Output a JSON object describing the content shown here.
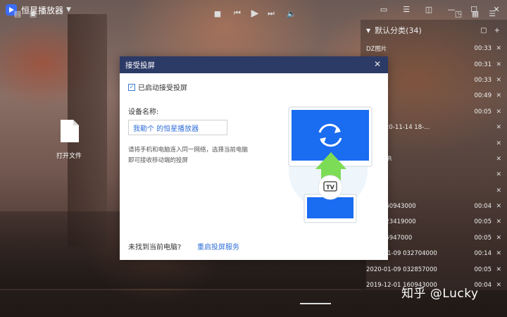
{
  "app": {
    "title": "恒星播放器"
  },
  "playlist": {
    "header": "默认分类(34)",
    "rows": [
      {
        "name": "DZ图片",
        "duration": "00:33"
      },
      {
        "name": "",
        "duration": "00:31"
      },
      {
        "name": "",
        "duration": "00:33"
      },
      {
        "name": "",
        "duration": "00:49"
      },
      {
        "name": "",
        "duration": "00:05"
      },
      {
        "name": "em 2020-11-14 18-...",
        "duration": ""
      },
      {
        "name": "022_LR",
        "duration": ""
      },
      {
        "name": "0023_LR",
        "duration": ""
      },
      {
        "name": "024_LR",
        "duration": ""
      },
      {
        "name": "027_LR",
        "duration": ""
      },
      {
        "name": "2-01 160943000",
        "duration": "00:04"
      },
      {
        "name": "2-20 023419000",
        "duration": "00:05"
      },
      {
        "name": "-09 005947000",
        "duration": "00:05"
      },
      {
        "name": "2020-01-09 032704000",
        "duration": "00:14"
      },
      {
        "name": "2020-01-09 032857000",
        "duration": "00:05"
      },
      {
        "name": "2019-12-01 160943000",
        "duration": "00:04"
      }
    ]
  },
  "open_file": {
    "label": "打开文件"
  },
  "dialog": {
    "title": "接受投屏",
    "enable_label": "已启动接受投屏",
    "device_label": "设备名称:",
    "device_value": "我勒个 的恒星播放器",
    "hint": "请将手机和电脑连入同一网络，选择当前电脑即可接收移动端的投屏",
    "not_found": "未找到当前电脑?",
    "restart_link": "重启投屏服务",
    "tv_label": "TV"
  },
  "watermark": "知乎 @Lucky",
  "colors": {
    "dialog_header": "#2c3a66",
    "accent_blue": "#1a6cf0",
    "link_blue": "#2f6ed8",
    "arrow_green": "#7ddc55"
  }
}
